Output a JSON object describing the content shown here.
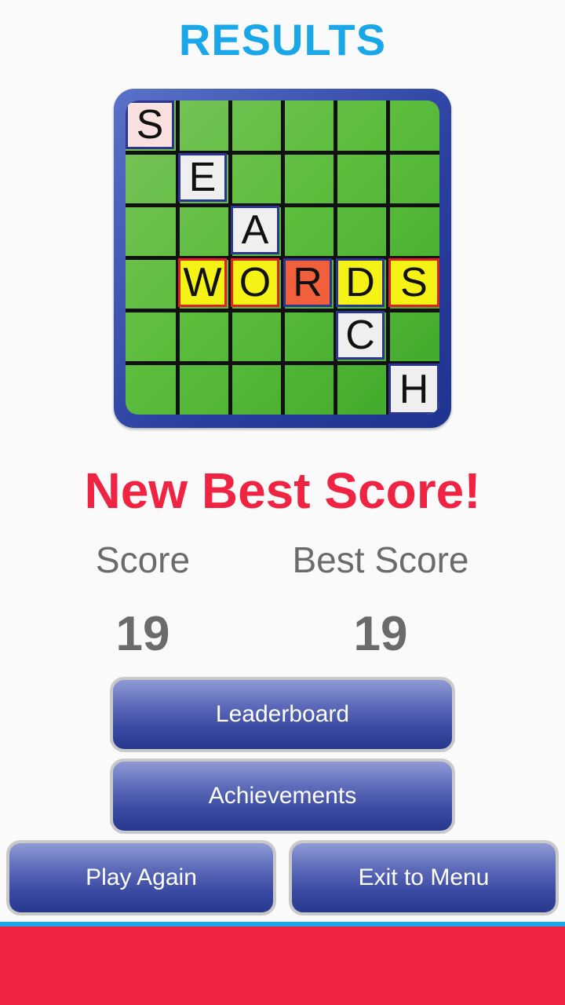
{
  "header": {
    "title": "RESULTS"
  },
  "logo": {
    "tiles": [
      "S",
      "E",
      "A",
      "W",
      "O",
      "R",
      "D",
      "S",
      "C",
      "H"
    ]
  },
  "result": {
    "headline": "New Best Score!",
    "score_label": "Score",
    "best_label": "Best Score",
    "score_value": "19",
    "best_value": "19"
  },
  "buttons": {
    "leaderboard": "Leaderboard",
    "achievements": "Achievements",
    "play_again": "Play Again",
    "exit_menu": "Exit to Menu"
  },
  "colors": {
    "title": "#1aa7ea",
    "headline": "#ef2443",
    "stat_text": "#6b6b6b",
    "button": "#3a4aa2",
    "bottom_bar": "#ef2443",
    "bottom_bar_border": "#1aa7ea"
  }
}
